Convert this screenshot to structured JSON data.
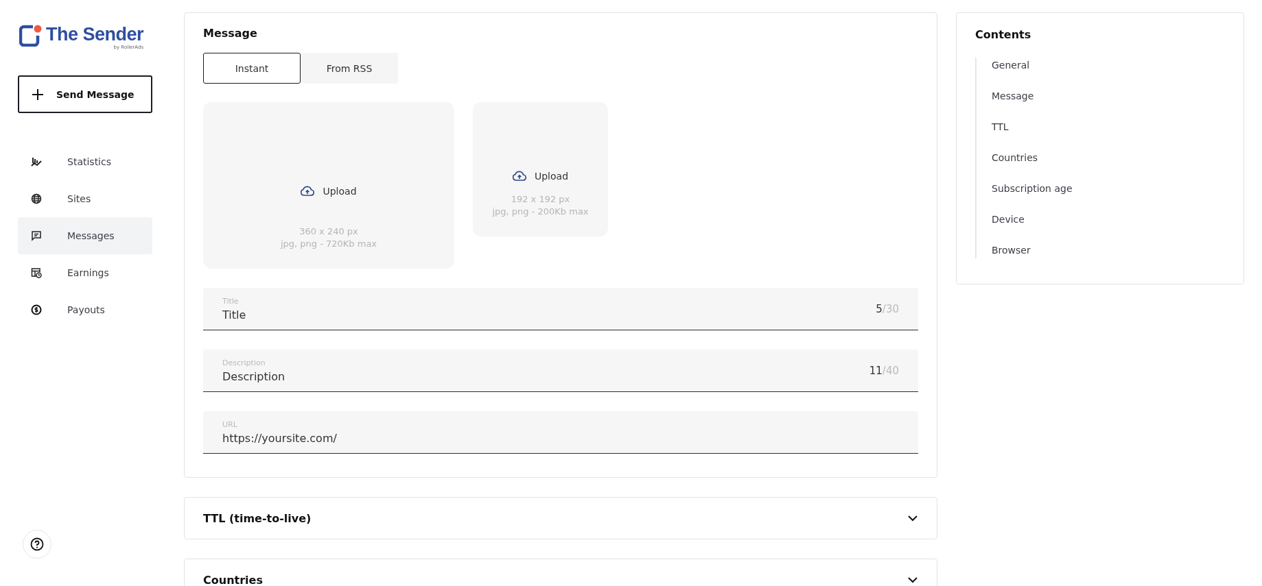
{
  "logo": {
    "name": "The Sender",
    "byline": "by RollerAds"
  },
  "send_button": {
    "label": "Send Message"
  },
  "nav": [
    {
      "label": "Statistics",
      "kind": "chart",
      "selected": false
    },
    {
      "label": "Sites",
      "kind": "globe",
      "selected": false
    },
    {
      "label": "Messages",
      "kind": "message",
      "selected": true
    },
    {
      "label": "Earnings",
      "kind": "earnings",
      "selected": false
    },
    {
      "label": "Payouts",
      "kind": "coin",
      "selected": false
    }
  ],
  "message": {
    "title": "Message",
    "tabs": [
      {
        "label": "Instant",
        "selected": true
      },
      {
        "label": "From RSS",
        "selected": false
      }
    ],
    "uploads": [
      {
        "kind": "large",
        "label": "Upload",
        "size": "360 x 240 px",
        "formats": "jpg, png - 720Kb max"
      },
      {
        "kind": "small",
        "label": "Upload",
        "size": "192 x 192 px",
        "formats": "jpg, png - 200Kb max"
      }
    ],
    "fields": [
      {
        "label": "Title",
        "value": "Title",
        "count": "5",
        "max": "/30"
      },
      {
        "label": "Description",
        "value": "Description",
        "count": "11",
        "max": "/40"
      },
      {
        "label": "URL",
        "value": "https://yoursite.com/"
      }
    ]
  },
  "sections": [
    {
      "title": "TTL (time-to-live)",
      "expanded": false
    },
    {
      "title": "Countries",
      "expanded": false
    }
  ],
  "contents": {
    "title": "Contents",
    "items": [
      "General",
      "Message",
      "TTL",
      "Countries",
      "Subscription age",
      "Device",
      "Browser"
    ]
  }
}
